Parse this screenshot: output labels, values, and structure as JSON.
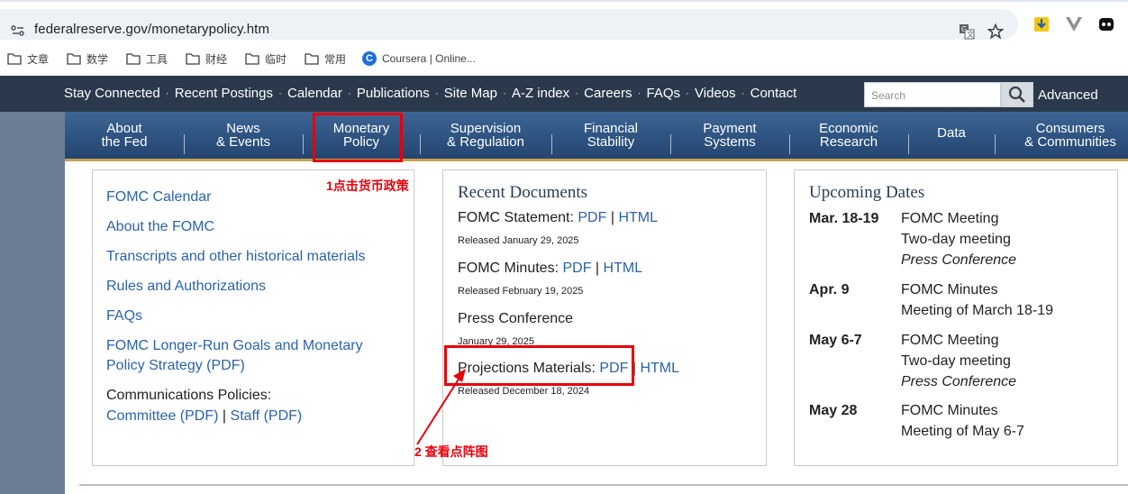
{
  "browser": {
    "url": "federalreserve.gov/monetarypolicy.htm",
    "bookmarks": [
      "文章",
      "数学",
      "工具",
      "财经",
      "临时",
      "常用",
      "Coursera | Online..."
    ]
  },
  "header": {
    "top_links": [
      "Stay Connected",
      "Recent Postings",
      "Calendar",
      "Publications",
      "Site Map",
      "A-Z index",
      "Careers",
      "FAQs",
      "Videos",
      "Contact"
    ],
    "search_placeholder": "Search",
    "advanced": "Advanced"
  },
  "nav": [
    {
      "line1": "About",
      "line2": "the Fed"
    },
    {
      "line1": "News",
      "line2": "& Events"
    },
    {
      "line1": "Monetary",
      "line2": "Policy"
    },
    {
      "line1": "Supervision",
      "line2": "& Regulation"
    },
    {
      "line1": "Financial",
      "line2": "Stability"
    },
    {
      "line1": "Payment",
      "line2": "Systems"
    },
    {
      "line1": "Economic",
      "line2": "Research"
    },
    {
      "line1": "Data",
      "line2": ""
    },
    {
      "line1": "Consumers",
      "line2": "& Communities"
    }
  ],
  "fomc_links": {
    "items": [
      "FOMC Calendar",
      "About the FOMC",
      "Transcripts and other historical materials",
      "Rules and Authorizations",
      "FAQs",
      "FOMC Longer-Run Goals and Monetary",
      "Policy Strategy (PDF)"
    ],
    "comm_label": "Communications Policies:",
    "committee": "Committee (PDF)",
    "sep": "|",
    "staff": "Staff (PDF)"
  },
  "recent_documents": {
    "title": "Recent Documents",
    "statement_label": "FOMC Statement:",
    "statement_date": "Released January 29, 2025",
    "minutes_label": "FOMC Minutes:",
    "minutes_date": "Released February 19, 2025",
    "press_label": "Press Conference",
    "press_date": "January 29, 2025",
    "projections_label": "Projections Materials:",
    "projections_date": "Released December 18, 2024",
    "pdf": "PDF",
    "html": "HTML",
    "sep": "|"
  },
  "upcoming": {
    "title": "Upcoming Dates",
    "events": [
      {
        "date": "Mar. 18-19",
        "line1": "FOMC Meeting",
        "line2": "Two-day meeting",
        "line3": "Press Conference"
      },
      {
        "date": "Apr. 9",
        "line1": "FOMC Minutes",
        "line2": "Meeting of March 18-19",
        "line3": ""
      },
      {
        "date": "May 6-7",
        "line1": "FOMC Meeting",
        "line2": "Two-day meeting",
        "line3": "Press Conference"
      },
      {
        "date": "May 28",
        "line1": "FOMC Minutes",
        "line2": "Meeting of May 6-7",
        "line3": ""
      }
    ]
  },
  "annotations": {
    "step1": "1点击货币政策",
    "step2": "2 查看点阵图",
    "color": "#e8000a"
  }
}
